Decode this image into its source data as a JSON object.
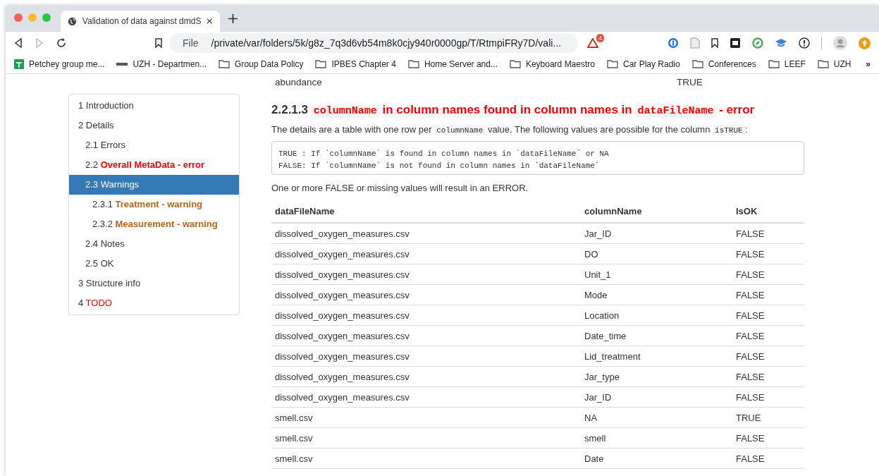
{
  "browser": {
    "tab_title": "Validation of data against dmdS",
    "address_scheme": "File",
    "address": "/private/var/folders/5k/g8z_7q3d6vb54m8k0cjy940r0000gp/T/RtmpiFRy7D/vali...",
    "extension_badge": "4",
    "bookmarks": [
      {
        "label": "Petchey group me...",
        "kind": "sheet"
      },
      {
        "label": "UZH - Departmen...",
        "kind": "uzh"
      },
      {
        "label": "Group Data Policy",
        "kind": "folder"
      },
      {
        "label": "IPBES Chapter 4",
        "kind": "folder"
      },
      {
        "label": "Home Server and...",
        "kind": "folder"
      },
      {
        "label": "Keyboard Maestro",
        "kind": "folder"
      },
      {
        "label": "Car Play Radio",
        "kind": "folder"
      },
      {
        "label": "Conferences",
        "kind": "folder"
      },
      {
        "label": "LEEF",
        "kind": "folder"
      },
      {
        "label": "UZH",
        "kind": "folder"
      }
    ],
    "bookmarks_more": "»"
  },
  "toc": [
    {
      "number": "1",
      "label": "Introduction",
      "kind": "plain",
      "selected": false
    },
    {
      "number": "2",
      "label": "Details",
      "kind": "plain",
      "selected": false,
      "children": [
        {
          "number": "2.1",
          "label": "Errors",
          "kind": "plain",
          "selected": false
        },
        {
          "number": "2.2",
          "label": "Overall MetaData - error",
          "kind": "error",
          "selected": false
        },
        {
          "number": "2.3",
          "label": "Warnings",
          "kind": "plain",
          "selected": true,
          "children": [
            {
              "number": "2.3.1",
              "label": "Treatment - warning",
              "kind": "warning",
              "selected": false
            },
            {
              "number": "2.3.2",
              "label": "Measurement - warning",
              "kind": "warning",
              "selected": false
            }
          ]
        },
        {
          "number": "2.4",
          "label": "Notes",
          "kind": "plain",
          "selected": false
        },
        {
          "number": "2.5",
          "label": "OK",
          "kind": "plain",
          "selected": false
        }
      ]
    },
    {
      "number": "3",
      "label": "Structure info",
      "kind": "plain",
      "selected": false
    },
    {
      "number": "4",
      "label": "TODO",
      "kind": "todo",
      "selected": false
    }
  ],
  "previous_row": [
    "abundance",
    "TRUE"
  ],
  "section": {
    "number": "2.2.1.3",
    "title": [
      {
        "kind": "code",
        "text": "columnName"
      },
      {
        "kind": "text",
        "text": " in column names found in column names in "
      },
      {
        "kind": "code",
        "text": "dataFileName"
      },
      {
        "kind": "text",
        "text": " - error"
      }
    ],
    "intro": [
      {
        "kind": "text",
        "text": "The details are a table with one row per "
      },
      {
        "kind": "code",
        "text": "columnName"
      },
      {
        "kind": "text",
        "text": " value. The following values are possible for the column "
      },
      {
        "kind": "code",
        "text": "isTRUE"
      },
      {
        "kind": "text",
        "text": ":"
      }
    ],
    "code_lines": [
      "TRUE : If `columnName` is found in column names in `dataFileName` or NA",
      "FALSE: If `columnName` is not found in column names in `dataFileName`"
    ],
    "note": "One or more FALSE or missing values will result in an ERROR."
  },
  "table": {
    "columns": [
      "dataFileName",
      "columnName",
      "IsOK"
    ],
    "rows": [
      [
        "dissolved_oxygen_measures.csv",
        "Jar_ID",
        "FALSE"
      ],
      [
        "dissolved_oxygen_measures.csv",
        "DO",
        "FALSE"
      ],
      [
        "dissolved_oxygen_measures.csv",
        "Unit_1",
        "FALSE"
      ],
      [
        "dissolved_oxygen_measures.csv",
        "Mode",
        "FALSE"
      ],
      [
        "dissolved_oxygen_measures.csv",
        "Location",
        "FALSE"
      ],
      [
        "dissolved_oxygen_measures.csv",
        "Date_time",
        "FALSE"
      ],
      [
        "dissolved_oxygen_measures.csv",
        "Lid_treatment",
        "FALSE"
      ],
      [
        "dissolved_oxygen_measures.csv",
        "Jar_type",
        "FALSE"
      ],
      [
        "dissolved_oxygen_measures.csv",
        "Jar_ID",
        "FALSE"
      ],
      [
        "smell.csv",
        "NA",
        "TRUE"
      ],
      [
        "smell.csv",
        "smell",
        "FALSE"
      ],
      [
        "smell.csv",
        "Date",
        "FALSE"
      ]
    ]
  }
}
